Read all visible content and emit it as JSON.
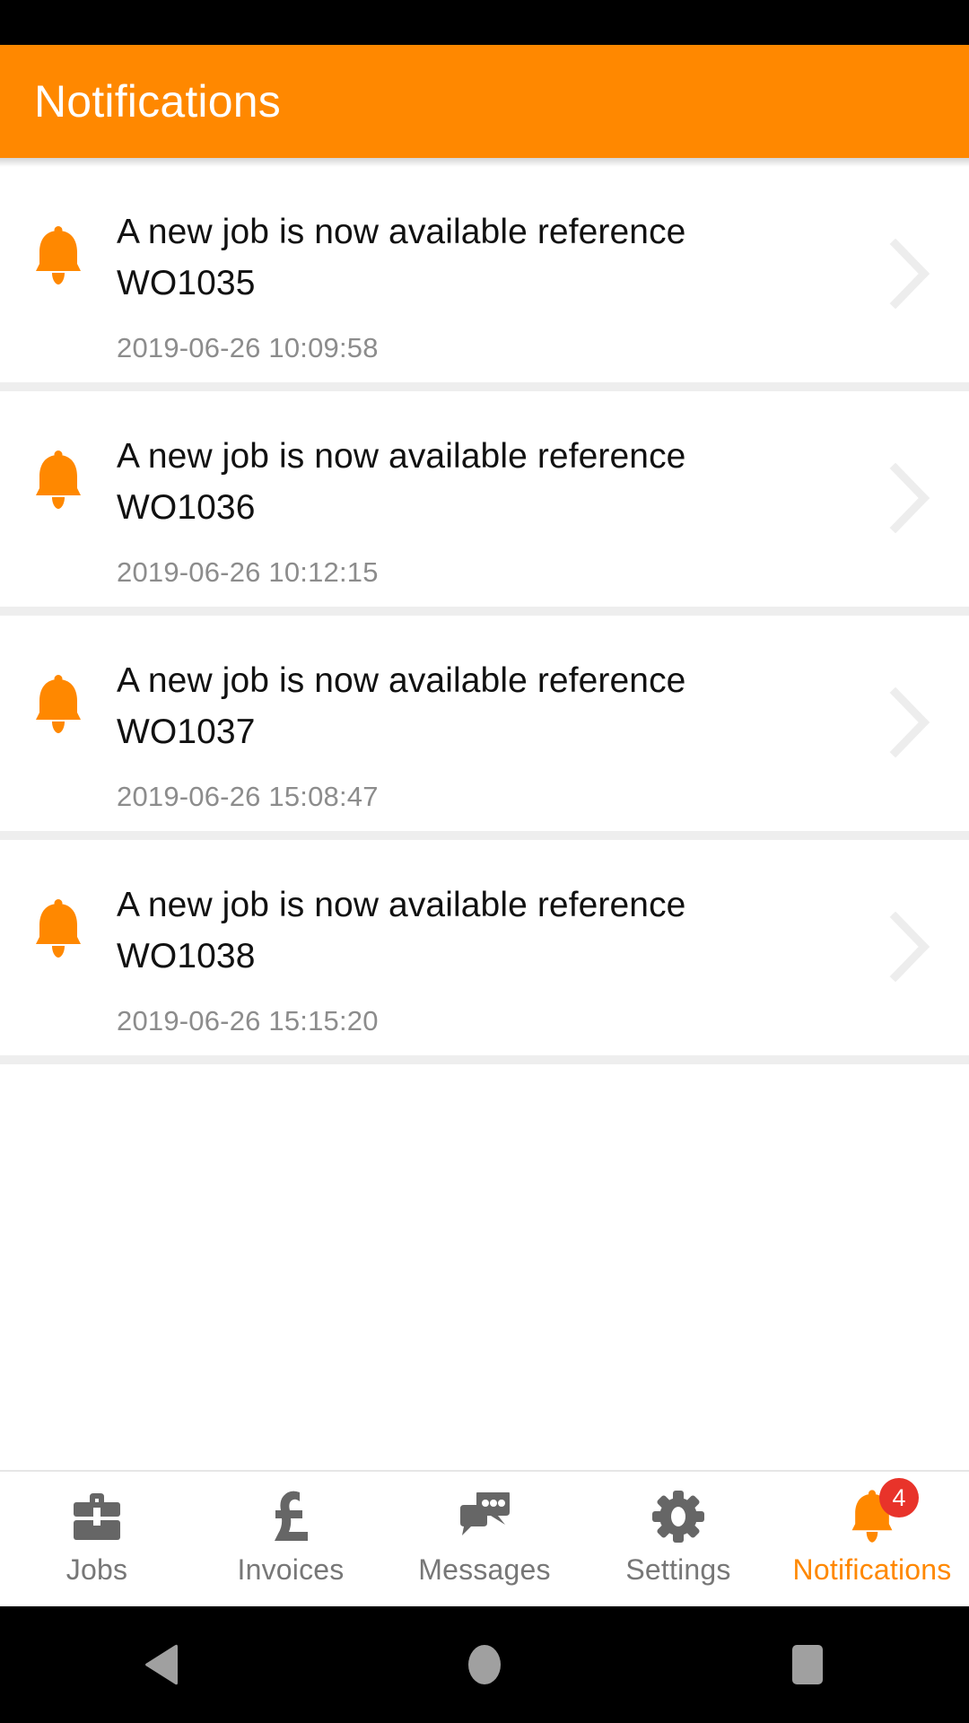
{
  "header": {
    "title": "Notifications",
    "background_color": "#ff8800",
    "text_color": "#ffffff"
  },
  "colors": {
    "accent": "#ff8800",
    "badge": "#e8332a",
    "divider": "#eeeeee",
    "timestamp_text": "#8c8c8c",
    "message_text": "#111111",
    "tab_inactive": "#777777",
    "chevron": "#ededed",
    "system_bar": "#000000"
  },
  "notifications": [
    {
      "icon": "bell-icon",
      "message": "A new job is now available reference WO1035",
      "reference": "WO1035",
      "timestamp": "2019-06-26 10:09:58",
      "chevron": "chevron-right-icon"
    },
    {
      "icon": "bell-icon",
      "message": "A new job is now available reference WO1036",
      "reference": "WO1036",
      "timestamp": "2019-06-26 10:12:15",
      "chevron": "chevron-right-icon"
    },
    {
      "icon": "bell-icon",
      "message": "A new job is now available reference WO1037",
      "reference": "WO1037",
      "timestamp": "2019-06-26 15:08:47",
      "chevron": "chevron-right-icon"
    },
    {
      "icon": "bell-icon",
      "message": "A new job is now available reference WO1038",
      "reference": "WO1038",
      "timestamp": "2019-06-26 15:15:20",
      "chevron": "chevron-right-icon"
    }
  ],
  "tabbar": {
    "items": [
      {
        "label": "Jobs",
        "icon": "briefcase-icon",
        "active": false,
        "badge": null
      },
      {
        "label": "Invoices",
        "icon": "pound-sign-icon",
        "active": false,
        "badge": null
      },
      {
        "label": "Messages",
        "icon": "chat-bubble-icon",
        "active": false,
        "badge": null
      },
      {
        "label": "Settings",
        "icon": "gear-icon",
        "active": false,
        "badge": null
      },
      {
        "label": "Notifications",
        "icon": "bell-icon",
        "active": true,
        "badge": "4"
      }
    ]
  },
  "system_nav": {
    "back": "back-triangle-icon",
    "home": "home-circle-icon",
    "recents": "recents-square-icon"
  }
}
